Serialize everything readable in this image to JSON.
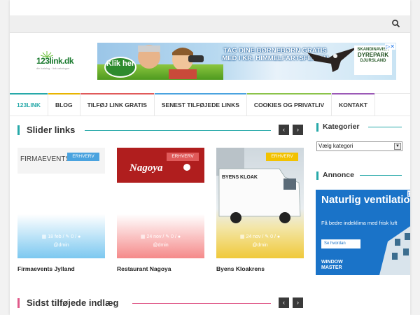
{
  "header": {
    "logo_text": "123link.dk",
    "logo_tagline": "din katalog · link catalogue",
    "banner": {
      "button": "Klik her",
      "headline": "TAG DINE BØRNEBØRN GRATIS MED I KR. HIMMELFARTSFERIEN",
      "brand_top": "SKANDINAVISK",
      "brand_mid": "DYREPARK",
      "brand_bottom": "DJURSLAND"
    }
  },
  "nav": {
    "items": [
      {
        "label": "123LINK",
        "color": "#27a9a9"
      },
      {
        "label": "BLOG",
        "color": "#e8b400"
      },
      {
        "label": "TILFØJ LINK GRATIS",
        "color": "#e05a5a"
      },
      {
        "label": "SENEST TILFØJEDE LINKS",
        "color": "#4aa3df"
      },
      {
        "label": "COOKIES OG PRIVATLIV",
        "color": "#8bc34a"
      },
      {
        "label": "KONTAKT",
        "color": "#9b59b6"
      }
    ]
  },
  "slider": {
    "title": "Slider links",
    "prev": "‹",
    "next": "›",
    "cards": [
      {
        "badge": "ERHVERV",
        "date": "18 feb",
        "comments": "0",
        "author": "@dmin",
        "title": "Firmaevents Jylland",
        "image_text": "FIRMAEVENTS"
      },
      {
        "badge": "ERHVERV",
        "date": "24 nov",
        "comments": "0",
        "author": "@dmin",
        "title": "Restaurant Nagoya",
        "image_text": "Nagoya"
      },
      {
        "badge": "ERHVERV",
        "date": "24 nov",
        "comments": "0",
        "author": "@dmin",
        "title": "Byens Kloakrens",
        "image_text": "BYENS KLOAK"
      }
    ]
  },
  "recent": {
    "title": "Sidst tilføjede indlæg",
    "prev": "‹",
    "next": "›"
  },
  "sidebar": {
    "categories_title": "Kategorier",
    "select_value": "Vælg kategori",
    "ad_title": "Annonce",
    "ad": {
      "headline": "Naturlig ventilation",
      "sub": "Få bedre indeklima med frisk luft",
      "button": "Se hvordan",
      "brand": "WINDOW MASTER"
    }
  }
}
